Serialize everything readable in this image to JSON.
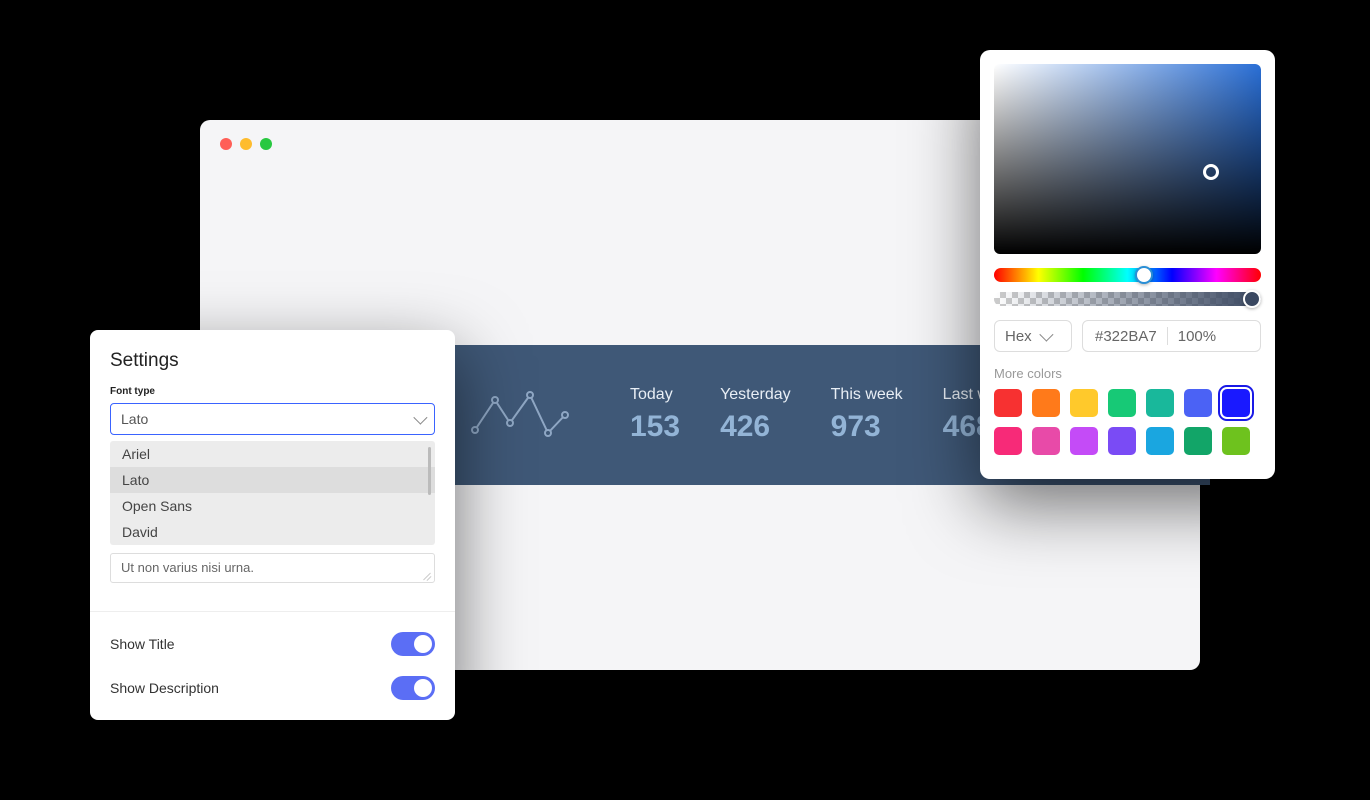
{
  "settings": {
    "title": "Settings",
    "font_label": "Font type",
    "font_selected": "Lato",
    "font_options": [
      "Ariel",
      "Lato",
      "Open Sans",
      "David"
    ],
    "textarea_value": "Ut non varius nisi urna.",
    "toggle_show_title": "Show Title",
    "toggle_show_description": "Show Description"
  },
  "stats": {
    "items": [
      {
        "label": "Today",
        "value": "153"
      },
      {
        "label": "Yesterday",
        "value": "426"
      },
      {
        "label": "This week",
        "value": "973"
      },
      {
        "label": "Last w",
        "value": "468"
      }
    ]
  },
  "color_picker": {
    "format_label": "Hex",
    "hex_value": "#322BA7",
    "opacity": "100%",
    "more_colors_label": "More colors",
    "swatches_row1": [
      "#f73131",
      "#ff7a1a",
      "#ffc92b",
      "#17c976",
      "#19b89b",
      "#4b62f5",
      "#1919ff"
    ],
    "swatches_row2": [
      "#f72a78",
      "#e84aa8",
      "#c44bf7",
      "#7a4bf5",
      "#1aa6e0",
      "#12a568",
      "#6ec21e"
    ],
    "selected_swatch_index": 6
  }
}
